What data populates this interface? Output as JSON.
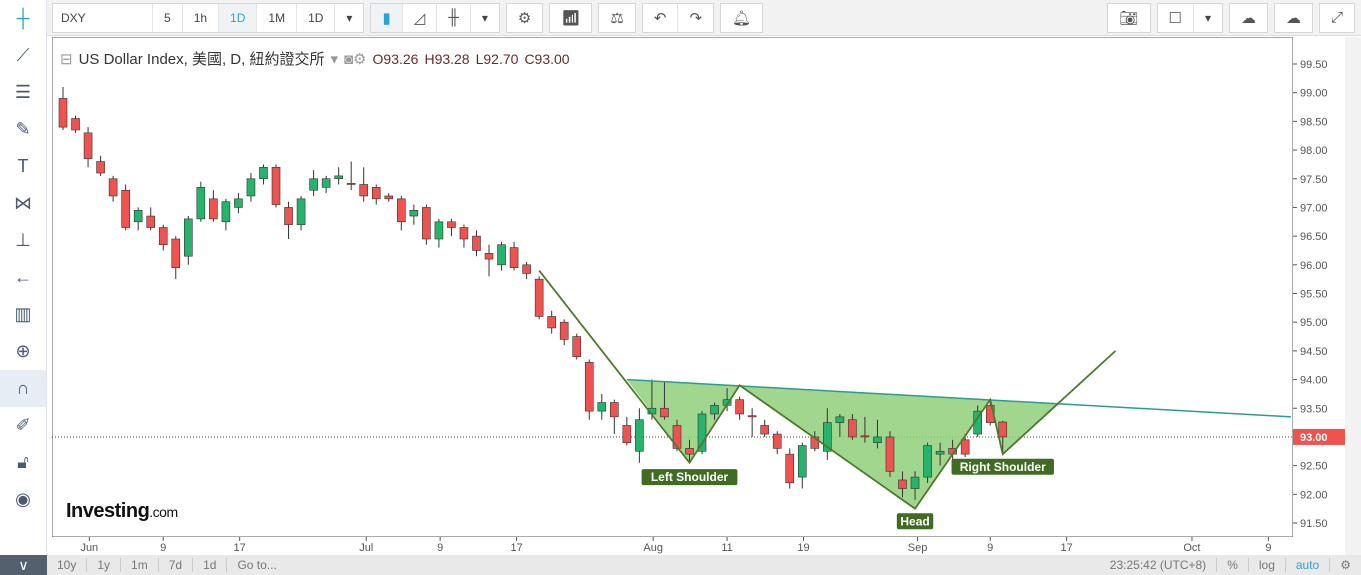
{
  "toolbar": {
    "symbol": "DXY",
    "intervals": [
      "5",
      "1h",
      "1D",
      "1M",
      "1D"
    ],
    "selected_interval": "1D"
  },
  "legend": {
    "title": "US Dollar Index, 美國, D, 紐約證交所",
    "open": "O93.26",
    "high": "H93.28",
    "low": "L92.70",
    "close": "C93.00"
  },
  "logo": {
    "brand": "Investing",
    "suffix": ".com"
  },
  "bottom": {
    "ranges": [
      "10y",
      "1y",
      "1m",
      "7d",
      "1d",
      "Go to..."
    ],
    "time": "23:25:42 (UTC+8)",
    "percent": "%",
    "log": "log",
    "auto": "auto"
  },
  "colors": {
    "up": "#26b36b",
    "down": "#ef5350",
    "pattern_line": "#4e7a2c",
    "pattern_fill": "#8fcf7a",
    "neckline": "#2a9d8f"
  },
  "chart_data": {
    "type": "candlestick",
    "title": "US Dollar Index, D",
    "current_price": "93.00",
    "ylim": [
      91.25,
      99.95
    ],
    "yticks": [
      "99.50",
      "99.00",
      "98.50",
      "98.00",
      "97.50",
      "97.00",
      "96.50",
      "96.00",
      "95.50",
      "95.00",
      "94.50",
      "94.00",
      "93.50",
      "93.00",
      "92.50",
      "92.00",
      "91.50"
    ],
    "xticks": [
      {
        "label": "Jun",
        "i": 2.1
      },
      {
        "label": "9",
        "i": 8
      },
      {
        "label": "17",
        "i": 14.1
      },
      {
        "label": "Jul",
        "i": 24.2
      },
      {
        "label": "9",
        "i": 30.1
      },
      {
        "label": "17",
        "i": 36.2
      },
      {
        "label": "Aug",
        "i": 47.1
      },
      {
        "label": "11",
        "i": 53
      },
      {
        "label": "19",
        "i": 59.1
      },
      {
        "label": "Sep",
        "i": 68.2
      },
      {
        "label": "9",
        "i": 74
      },
      {
        "label": "17",
        "i": 80.1
      },
      {
        "label": "Oct",
        "i": 90.1
      },
      {
        "label": "9",
        "i": 96.2
      }
    ],
    "ohlc": [
      [
        98.9,
        99.1,
        98.35,
        98.4
      ],
      [
        98.55,
        98.6,
        98.3,
        98.35
      ],
      [
        98.3,
        98.4,
        97.7,
        97.85
      ],
      [
        97.8,
        97.9,
        97.55,
        97.6
      ],
      [
        97.5,
        97.55,
        97.1,
        97.2
      ],
      [
        97.3,
        97.4,
        96.6,
        96.65
      ],
      [
        96.75,
        97.0,
        96.6,
        96.95
      ],
      [
        96.85,
        97.0,
        96.6,
        96.65
      ],
      [
        96.65,
        96.7,
        96.25,
        96.35
      ],
      [
        96.45,
        96.5,
        95.75,
        95.95
      ],
      [
        96.15,
        96.85,
        96.0,
        96.8
      ],
      [
        96.8,
        97.45,
        96.75,
        97.35
      ],
      [
        97.15,
        97.3,
        96.75,
        96.8
      ],
      [
        96.75,
        97.15,
        96.6,
        97.1
      ],
      [
        97.0,
        97.25,
        96.9,
        97.15
      ],
      [
        97.2,
        97.6,
        97.1,
        97.5
      ],
      [
        97.5,
        97.75,
        97.4,
        97.7
      ],
      [
        97.7,
        97.75,
        97.0,
        97.05
      ],
      [
        97.0,
        97.1,
        96.45,
        96.7
      ],
      [
        96.7,
        97.2,
        96.6,
        97.15
      ],
      [
        97.3,
        97.65,
        97.2,
        97.5
      ],
      [
        97.35,
        97.55,
        97.25,
        97.5
      ],
      [
        97.5,
        97.7,
        97.4,
        97.55
      ],
      [
        97.42,
        97.8,
        97.3,
        97.4
      ],
      [
        97.4,
        97.7,
        97.1,
        97.2
      ],
      [
        97.35,
        97.4,
        97.05,
        97.15
      ],
      [
        97.2,
        97.25,
        97.1,
        97.15
      ],
      [
        97.15,
        97.2,
        96.6,
        96.75
      ],
      [
        96.85,
        97.05,
        96.7,
        96.95
      ],
      [
        97.0,
        97.05,
        96.35,
        96.45
      ],
      [
        96.45,
        96.8,
        96.3,
        96.75
      ],
      [
        96.75,
        96.8,
        96.5,
        96.65
      ],
      [
        96.65,
        96.7,
        96.3,
        96.45
      ],
      [
        96.5,
        96.6,
        96.15,
        96.25
      ],
      [
        96.2,
        96.35,
        95.8,
        96.1
      ],
      [
        96.0,
        96.4,
        95.9,
        96.35
      ],
      [
        96.3,
        96.4,
        95.9,
        95.95
      ],
      [
        96.0,
        96.05,
        95.75,
        95.85
      ],
      [
        95.75,
        95.8,
        95.05,
        95.1
      ],
      [
        95.1,
        95.2,
        94.8,
        94.9
      ],
      [
        95.0,
        95.05,
        94.6,
        94.7
      ],
      [
        94.75,
        94.8,
        94.35,
        94.4
      ],
      [
        94.3,
        94.35,
        93.3,
        93.45
      ],
      [
        93.45,
        93.75,
        93.3,
        93.6
      ],
      [
        93.6,
        93.65,
        93.05,
        93.35
      ],
      [
        93.2,
        93.35,
        92.85,
        92.9
      ],
      [
        92.75,
        93.5,
        92.55,
        93.3
      ],
      [
        93.4,
        94.0,
        93.3,
        93.5
      ],
      [
        93.5,
        93.95,
        93.3,
        93.35
      ],
      [
        93.2,
        93.3,
        92.75,
        92.8
      ],
      [
        92.8,
        92.95,
        92.55,
        92.7
      ],
      [
        92.75,
        93.45,
        92.7,
        93.4
      ],
      [
        93.4,
        93.6,
        93.3,
        93.55
      ],
      [
        93.55,
        93.85,
        93.45,
        93.65
      ],
      [
        93.65,
        93.7,
        93.3,
        93.4
      ],
      [
        93.37,
        93.5,
        93.0,
        93.35
      ],
      [
        93.2,
        93.3,
        93.0,
        93.05
      ],
      [
        93.05,
        93.1,
        92.7,
        92.8
      ],
      [
        92.7,
        92.8,
        92.1,
        92.2
      ],
      [
        92.3,
        92.9,
        92.1,
        92.85
      ],
      [
        93.0,
        93.1,
        92.75,
        92.8
      ],
      [
        92.75,
        93.5,
        92.6,
        93.25
      ],
      [
        93.25,
        93.4,
        93.0,
        93.35
      ],
      [
        93.3,
        93.4,
        92.95,
        93.0
      ],
      [
        93.02,
        93.35,
        92.9,
        93.0
      ],
      [
        92.9,
        93.3,
        92.8,
        93.0
      ],
      [
        93.0,
        93.1,
        92.3,
        92.4
      ],
      [
        92.25,
        92.4,
        91.95,
        92.1
      ],
      [
        92.1,
        92.4,
        91.9,
        92.3
      ],
      [
        92.3,
        92.9,
        92.2,
        92.85
      ],
      [
        92.7,
        92.9,
        92.5,
        92.75
      ],
      [
        92.8,
        92.95,
        92.5,
        92.7
      ],
      [
        92.95,
        93.05,
        92.65,
        92.7
      ],
      [
        93.05,
        93.55,
        93.0,
        93.45
      ],
      [
        93.55,
        93.65,
        93.2,
        93.25
      ],
      [
        93.26,
        93.28,
        92.7,
        93.0
      ]
    ],
    "annotations": {
      "pattern_points": [
        [
          38,
          95.9
        ],
        [
          50,
          92.55
        ],
        [
          54,
          93.9
        ],
        [
          68,
          91.75
        ],
        [
          74,
          93.65
        ],
        [
          75,
          92.7
        ],
        [
          84,
          94.5
        ]
      ],
      "neckline": [
        [
          45,
          94.0
        ],
        [
          98,
          93.35
        ]
      ],
      "labels": [
        {
          "text": "Left Shoulder",
          "i": 50,
          "p": 92.3
        },
        {
          "text": "Head",
          "i": 68,
          "p": 91.53
        },
        {
          "text": "Right Shoulder",
          "i": 75,
          "p": 92.48
        }
      ]
    }
  }
}
